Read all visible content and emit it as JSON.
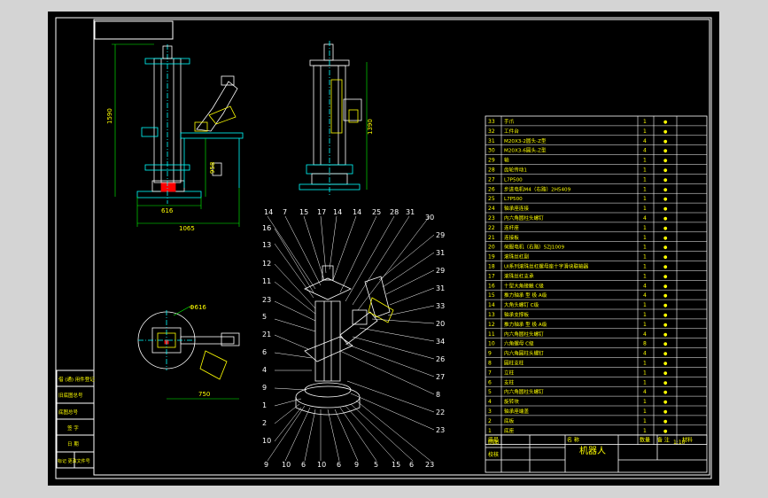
{
  "drawing": {
    "title": "机器人",
    "scale": "1:10",
    "dims": {
      "height_front": "1590",
      "lower_height": "958",
      "base_width": "616",
      "total_width": "1065",
      "side_height": "1390",
      "plan_dia": "Φ616",
      "plan_width": "750"
    },
    "bom_header": {
      "no": "序号",
      "name": "名 称",
      "qty": "数量",
      "material": "备 注",
      "remark": "材料"
    },
    "bom": [
      {
        "no": "33",
        "name": "手爪",
        "qty": "1",
        "mark": "●"
      },
      {
        "no": "32",
        "name": "工件台",
        "qty": "1",
        "mark": "●"
      },
      {
        "no": "31",
        "name": "M20X3-2圆头-Z型",
        "qty": "4",
        "mark": "●"
      },
      {
        "no": "30",
        "name": "M20X3-6圆头-Z型",
        "qty": "4",
        "mark": "●"
      },
      {
        "no": "29",
        "name": "轴",
        "qty": "1",
        "mark": "●"
      },
      {
        "no": "28",
        "name": "齿轮传动1",
        "qty": "1",
        "mark": "●"
      },
      {
        "no": "27",
        "name": "L7P500",
        "qty": "1",
        "mark": "●"
      },
      {
        "no": "26",
        "name": "步进电机M4（右路）2H5409",
        "qty": "1",
        "mark": "●"
      },
      {
        "no": "25",
        "name": "L7P500",
        "qty": "1",
        "mark": "●"
      },
      {
        "no": "24",
        "name": "轴承座连接",
        "qty": "1",
        "mark": "●"
      },
      {
        "no": "23",
        "name": "内六角圆柱头螺钉",
        "qty": "4",
        "mark": "●"
      },
      {
        "no": "22",
        "name": "连杆座",
        "qty": "1",
        "mark": "●"
      },
      {
        "no": "21",
        "name": "连接板",
        "qty": "1",
        "mark": "●"
      },
      {
        "no": "20",
        "name": "伺服电机（右路）5ZJ1009",
        "qty": "1",
        "mark": "●"
      },
      {
        "no": "19",
        "name": "滚珠丝杠副",
        "qty": "1",
        "mark": "●"
      },
      {
        "no": "18",
        "name": "UI系列滚珠丝杠螺母座十字滑块联轴器",
        "qty": "1",
        "mark": "●"
      },
      {
        "no": "17",
        "name": "滚珠丝杠支承",
        "qty": "1",
        "mark": "●"
      },
      {
        "no": "16",
        "name": "十型大角接触 C级",
        "qty": "4",
        "mark": "●"
      },
      {
        "no": "15",
        "name": "推力轴承 型 极 A级",
        "qty": "4",
        "mark": "●"
      },
      {
        "no": "14",
        "name": "大角头螺钉 C级",
        "qty": "1",
        "mark": "●"
      },
      {
        "no": "13",
        "name": "轴承支撑板",
        "qty": "1",
        "mark": "●"
      },
      {
        "no": "12",
        "name": "推力轴承 型 极 A级",
        "qty": "1",
        "mark": "●"
      },
      {
        "no": "11",
        "name": "内六角圆柱头螺钉",
        "qty": "4",
        "mark": "●"
      },
      {
        "no": "10",
        "name": "六角螺母 C级",
        "qty": "8",
        "mark": "●"
      },
      {
        "no": "9",
        "name": "内六角圆柱头螺钉",
        "qty": "4",
        "mark": "●"
      },
      {
        "no": "8",
        "name": "圆柱支柱",
        "qty": "1",
        "mark": "●"
      },
      {
        "no": "7",
        "name": "立柱",
        "qty": "1",
        "mark": "●"
      },
      {
        "no": "6",
        "name": "支柱",
        "qty": "1",
        "mark": "●"
      },
      {
        "no": "5",
        "name": "内六角圆柱头螺钉",
        "qty": "4",
        "mark": "●"
      },
      {
        "no": "4",
        "name": "旋转块",
        "qty": "1",
        "mark": "●"
      },
      {
        "no": "3",
        "name": "轴承座端盖",
        "qty": "1",
        "mark": "●"
      },
      {
        "no": "2",
        "name": "底板",
        "qty": "1",
        "mark": "●"
      },
      {
        "no": "1",
        "name": "底座",
        "qty": "1",
        "mark": "●"
      }
    ],
    "title_block": {
      "draw": "制图",
      "check": "校核"
    },
    "left_strip": [
      "借 (通) 用件登记",
      "旧底图总号",
      "底图总号",
      "签 字",
      "日 期",
      "标记 更改文件号"
    ],
    "callouts_top": [
      "14",
      "7",
      "15",
      "17",
      "14",
      "14",
      "25",
      "28",
      "31",
      "30"
    ],
    "callouts_left": [
      "16",
      "13",
      "12",
      "11",
      "23",
      "5",
      "21",
      "6",
      "4",
      "9",
      "1",
      "2",
      "10"
    ],
    "callouts_right": [
      "29",
      "31",
      "29",
      "31",
      "33",
      "20",
      "34",
      "26",
      "27",
      "8",
      "22",
      "23"
    ],
    "callouts_bottom": [
      "9",
      "10",
      "6",
      "10",
      "6",
      "9",
      "5",
      "15",
      "6",
      "23"
    ]
  }
}
